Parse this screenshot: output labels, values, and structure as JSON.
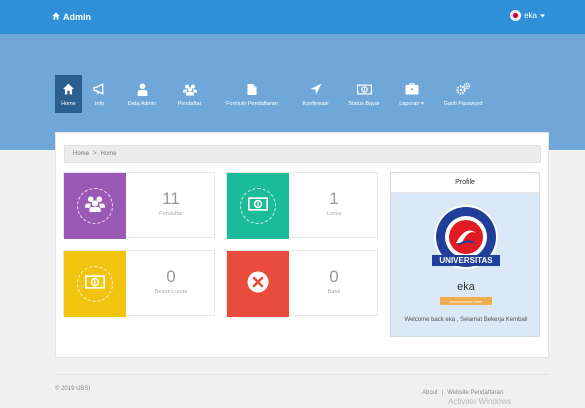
{
  "topbar": {
    "brand": "Admin",
    "user": "eka"
  },
  "nav": [
    {
      "label": "Home",
      "icon": "home-icon",
      "active": true
    },
    {
      "label": "Info",
      "icon": "megaphone-icon",
      "active": false
    },
    {
      "label": "Data Admin",
      "icon": "user-icon",
      "active": false
    },
    {
      "label": "Pendaftar",
      "icon": "users-icon",
      "active": false
    },
    {
      "label": "Formulir Pendaftaran",
      "icon": "file-icon",
      "active": false
    },
    {
      "label": "Konfirmasi",
      "icon": "send-icon",
      "active": false
    },
    {
      "label": "Status Bayar",
      "icon": "money-icon",
      "active": false
    },
    {
      "label": "Laporan",
      "icon": "briefcase-icon",
      "active": false
    },
    {
      "label": "Ganti Password",
      "icon": "gears-icon",
      "active": false
    }
  ],
  "breadcrumb": {
    "home": "Home",
    "separator": ">",
    "current": "Home"
  },
  "stats": [
    {
      "number": "11",
      "label": "Pendaftar",
      "color": "#9b59b6",
      "icon": "users-icon"
    },
    {
      "number": "1",
      "label": "Lunas",
      "color": "#1abc9c",
      "icon": "money-icon"
    },
    {
      "number": "0",
      "label": "Belum Lunas",
      "color": "#f1c40f",
      "icon": "money-icon"
    },
    {
      "number": "0",
      "label": "Batal",
      "color": "#e74c3c",
      "icon": "close-icon"
    }
  ],
  "profile": {
    "title": "Profile",
    "logo_text": "UNIVERSITAS",
    "name": "eka",
    "badge": "Administrator Web",
    "welcome": "Welcome back eka , Selamat Bekerja Kembali"
  },
  "footer": {
    "copyright": "© 2019 UBSI",
    "about": "About",
    "separator": "|",
    "website": "Website Pendaftaran"
  },
  "watermark": "Activate Windows"
}
